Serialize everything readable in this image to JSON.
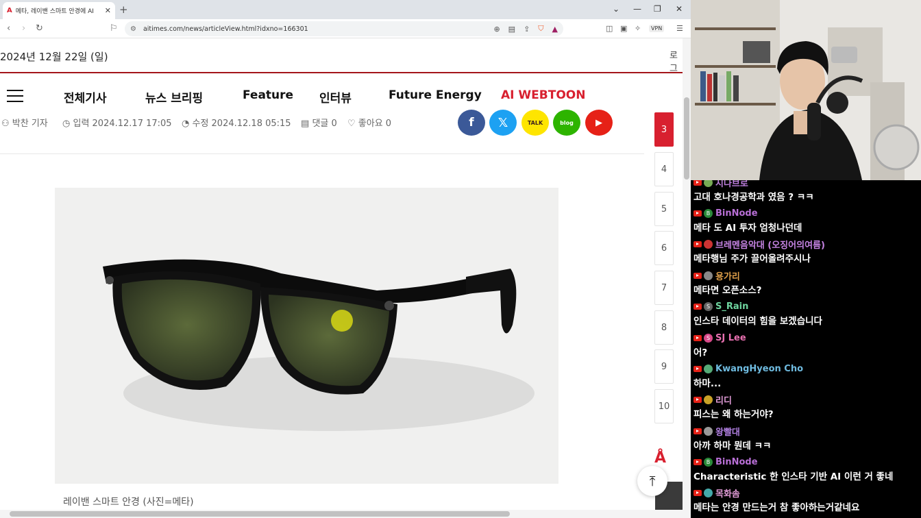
{
  "browser": {
    "tab_title": "메타, 레이밴 스마트 안경에 AI",
    "url": "aitimes.com/news/articleView.html?idxno=166301",
    "vpn_label": "VPN"
  },
  "site": {
    "date": "2024년 12월 22일 (일)",
    "login_partial": "로그",
    "nav": [
      "전체기사",
      "뉴스 브리핑",
      "Feature",
      "인터뷰",
      "Future Energy",
      "AI WEBTOON"
    ],
    "nav_highlight_color": "#d8202f",
    "brand_color": "#a4161a"
  },
  "article": {
    "author": "박찬 기자",
    "input_date": "입력 2024.12.17 17:05",
    "modified_date": "수정 2024.12.18 05:15",
    "comments": "댓글 0",
    "likes": "좋아요 0",
    "caption": "레이밴 스마트 안경 (사진=메타)"
  },
  "social": {
    "facebook": {
      "glyph": "f",
      "color": "#3b5998"
    },
    "x": {
      "glyph": "𝕏",
      "color": "#1da1f2"
    },
    "kakao": {
      "glyph": "TALK",
      "color": "#fee500"
    },
    "blog": {
      "glyph": "blog",
      "color": "#2db400"
    },
    "youtube": {
      "glyph": "▶",
      "color": "#e62117"
    }
  },
  "rankings": [
    "3",
    "4",
    "5",
    "6",
    "7",
    "8",
    "9",
    "10"
  ],
  "chat": [
    {
      "user": "시나브로",
      "color": "#c080e0",
      "avatar": "#7a5",
      "text": "고대 호나경공학과 였음 ? ㅋㅋ"
    },
    {
      "user": "BinNode",
      "color": "#b86fd6",
      "avatar": "#2a8a3a",
      "text": "메타 도 AI 투자 엄청나던데"
    },
    {
      "user": "브레멘음악대 (오징어의여름)",
      "color": "#c583e3",
      "avatar": "#c33",
      "text": "메타행님 주가 끌어올려주시나"
    },
    {
      "user": "용가리",
      "color": "#e0a04a",
      "avatar": "#888",
      "text": "메타면 오픈소스?"
    },
    {
      "user": "S_Rain",
      "color": "#6fd6a0",
      "avatar": "#666",
      "text": "인스타 데이터의 힘을 보겠습니다"
    },
    {
      "user": "SJ Lee",
      "color": "#e870b0",
      "avatar": "#d84a8a",
      "text": "어?"
    },
    {
      "user": "KwangHyeon Cho",
      "color": "#6fbbe0",
      "avatar": "#5a7",
      "text": "하마..."
    },
    {
      "user": "리디",
      "color": "#e09bd6",
      "avatar": "#c9a227",
      "text": "피스는 왜 하는거야?"
    },
    {
      "user": "왕빨대",
      "color": "#b07fe0",
      "avatar": "#999",
      "text": "아까 하마 뭔데 ㅋㅋ"
    },
    {
      "user": "BinNode",
      "color": "#b86fd6",
      "avatar": "#2a8a3a",
      "text": "Characteristic 한 인스타 기반 AI 이런 거 좋네"
    },
    {
      "user": "목화솜",
      "color": "#e09bd6",
      "avatar": "#4aa",
      "text": "메타는 안경 만드는거 참 좋아하는거같네요"
    }
  ]
}
